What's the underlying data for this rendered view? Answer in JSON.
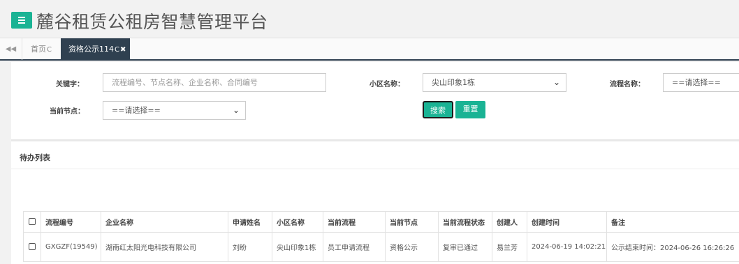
{
  "app": {
    "title": "麓谷租赁公租房智慧管理平台"
  },
  "tabs": {
    "home_label": "首页",
    "active_label": "资格公示114",
    "refresh_glyph": "C",
    "close_glyph": "✖",
    "nav_back_glyph": "◀◀"
  },
  "search": {
    "keyword_label": "关键字：",
    "keyword_placeholder": "流程编号、节点名称、企业名称、合同编号",
    "community_label": "小区名称：",
    "community_value": "尖山印象1栋",
    "process_label": "流程名称：",
    "process_value": "==请选择==",
    "node_label": "当前节点：",
    "node_value": "==请选择==",
    "search_button": "搜索",
    "reset_button": "重置"
  },
  "list": {
    "title": "待办列表",
    "columns": [
      "流程编号",
      "企业名称",
      "申请姓名",
      "小区名称",
      "当前流程",
      "当前节点",
      "当前流程状态",
      "创建人",
      "创建时间",
      "备注"
    ],
    "rows": [
      {
        "process_no": "GXGZF(19549)",
        "company": "湖南红太阳光电科技有限公司",
        "applicant": "刘盼",
        "community": "尖山印象1栋",
        "flow": "员工申请流程",
        "node": "资格公示",
        "status": "复审已通过",
        "creator": "易兰芳",
        "created_at": "2024-06-19 14:02:21",
        "remark": "公示结束时间：2024-06-26 16:26:26"
      }
    ]
  },
  "colors": {
    "accent": "#1ab394",
    "dark_tab": "#2f4050"
  }
}
